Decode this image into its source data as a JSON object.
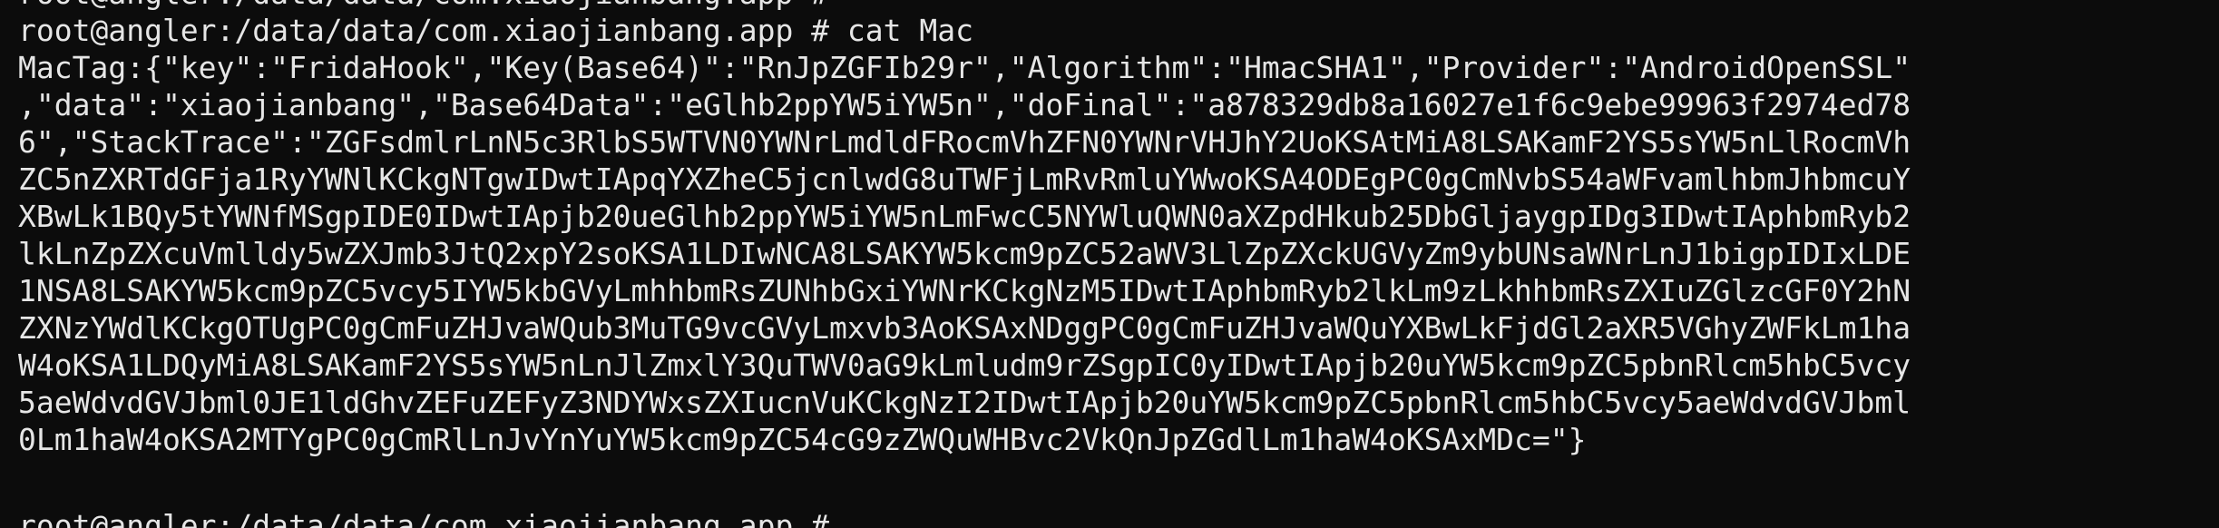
{
  "terminal": {
    "previous_prompt_partial": "root@angler:/data/data/com.xiaojianbang.app #",
    "prompt": "root@angler:/data/data/com.xiaojianbang.app # ",
    "command": "cat Mac",
    "output_lines": [
      "MacTag:{\"key\":\"FridaHook\",\"Key(Base64)\":\"RnJpZGFIb29r\",\"Algorithm\":\"HmacSHA1\",\"Provider\":\"AndroidOpenSSL\"",
      ",\"data\":\"xiaojianbang\",\"Base64Data\":\"eGlhb2ppYW5iYW5n\",\"doFinal\":\"a878329db8a16027e1f6c9ebe99963f2974ed78",
      "6\",\"StackTrace\":\"ZGFsdmlrLnN5c3RlbS5WTVN0YWNrLmdldFRocmVhZFN0YWNrVHJhY2UoKSAtMiA8LSAKamF2YS5sYW5nLlRocmVh",
      "ZC5nZXRTdGFja1RyYWNlKCkgNTgwIDwtIApqYXZheC5jcnlwdG8uTWFjLmRvRmluYWwoKSA4ODEgPC0gCmNvbS54aWFvamlhbmJhbmcuY",
      "XBwLk1BQy5tYWNfMSgpIDE0IDwtIApjb20ueGlhb2ppYW5iYW5nLmFwcC5NYWluQWN0aXZpdHkub25DbGljaygpIDg3IDwtIAphbmRyb2",
      "lkLnZpZXcuVmlldy5wZXJmb3JtQ2xpY2soKSA1LDIwNCA8LSAKYW5kcm9pZC52aWV3LlZpZXckUGVyZm9ybUNsaWNrLnJ1bigpIDIxLDE",
      "1NSA8LSAKYW5kcm9pZC5vcy5IYW5kbGVyLmhhbmRsZUNhbGxiYWNrKCkgNzM5IDwtIAphbmRyb2lkLm9zLkhhbmRsZXIuZGlzcGF0Y2hN",
      "ZXNzYWdlKCkgOTUgPC0gCmFuZHJvaWQub3MuTG9vcGVyLmxvb3AoKSAxNDggPC0gCmFuZHJvaWQuYXBwLkFjdGl2aXR5VGhyZWFkLm1ha",
      "W4oKSA1LDQyMiA8LSAKamF2YS5sYW5nLnJlZmxlY3QuTWV0aG9kLmludm9rZSgpIC0yIDwtIApjb20uYW5kcm9pZC5pbnRlcm5hbC5vcy",
      "5aeWdvdGVJbml0JE1ldGhvZEFuZEFyZ3NDYWxsZXIucnVuKCkgNzI2IDwtIApjb20uYW5kcm9pZC5pbnRlcm5hbC5vcy5aeWdvdGVJbml",
      "0Lm1haW4oKSA2MTYgPC0gCmRlLnJvYnYuYW5kcm9pZC54cG9zZWQuWHBvc2VkQnJpZGdlLm1haW4oKSAxMDc=\"}"
    ],
    "next_prompt_partial": "root@angler:/data/data/com.xiaojianbang.app #"
  }
}
